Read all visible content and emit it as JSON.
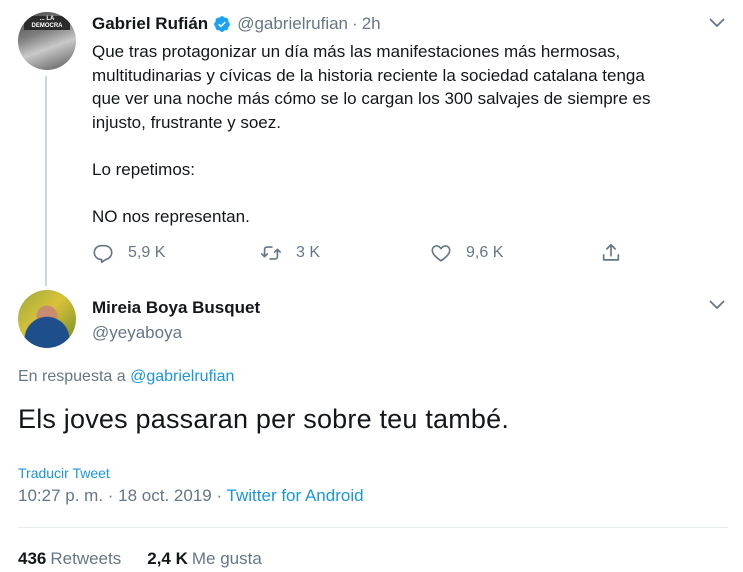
{
  "tweet1": {
    "avatar_text": "... LA DEMOCRA",
    "name": "Gabriel Rufián",
    "handle": "@gabrielrufian",
    "separator": "·",
    "time": "2h",
    "lines": [
      "Que tras protagonizar un día más las manifestaciones más hermosas,",
      "multitudinarias y cívicas de la historia reciente la sociedad catalana tenga",
      "que ver una noche más cómo se lo cargan los 300 salvajes de siempre es",
      "injusto, frustrante y soez."
    ],
    "line_repeat": "Lo repetimos:",
    "line_final": "NO nos representan.",
    "replies": "5,9 K",
    "retweets": "3 K",
    "likes": "9,6 K"
  },
  "tweet2": {
    "name": "Mireia Boya Busquet",
    "handle": "@yeyaboya",
    "reply_prefix": "En respuesta a ",
    "reply_handle": "@gabrielrufian",
    "text": "Els joves passaran per sobre teu també.",
    "translate": "Traducir Tweet",
    "timestamp": "10:27 p. m. · 18 oct. 2019 · ",
    "client": "Twitter for Android",
    "retweet_count": "436",
    "retweet_label": "Retweets",
    "like_count": "2,4 K",
    "like_label": "Me gusta"
  },
  "colors": {
    "link": "#1b95e0",
    "secondary": "#657786",
    "text": "#14171a",
    "verified": "#1da1f2"
  },
  "icons": [
    "verified-badge-icon",
    "chevron-down-icon",
    "reply-icon",
    "retweet-icon",
    "like-icon",
    "share-icon"
  ]
}
